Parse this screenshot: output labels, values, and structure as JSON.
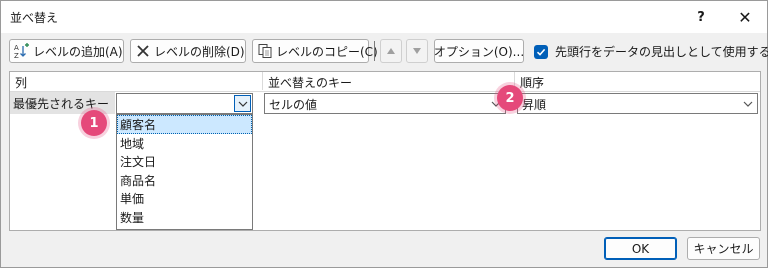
{
  "window": {
    "title": "並べ替え",
    "help": "?",
    "close": "✕"
  },
  "toolbar": {
    "add_label": "レベルの追加(A)",
    "delete_label": "レベルの削除(D)",
    "copy_label": "レベルのコピー(C)",
    "options_label": "オプション(O)...",
    "header_checkbox_label": "先頭行をデータの見出しとして使用する(H)",
    "header_checkbox_checked": true
  },
  "grid": {
    "headers": {
      "column": "列",
      "sort_on": "並べ替えのキー",
      "order": "順序"
    },
    "rows": [
      {
        "label": "最優先されるキー",
        "column_value": "",
        "sort_on_value": "セルの値",
        "order_value": "昇順"
      }
    ],
    "column_options": [
      "顧客名",
      "地域",
      "注文日",
      "商品名",
      "単価",
      "数量"
    ],
    "selected_option": "顧客名"
  },
  "badges": {
    "one": "1",
    "two": "2"
  },
  "buttons": {
    "ok": "OK",
    "cancel": "キャンセル"
  },
  "colors": {
    "accent": "#005fb8",
    "badge": "#e5497a",
    "selection": "#cce8ff"
  }
}
